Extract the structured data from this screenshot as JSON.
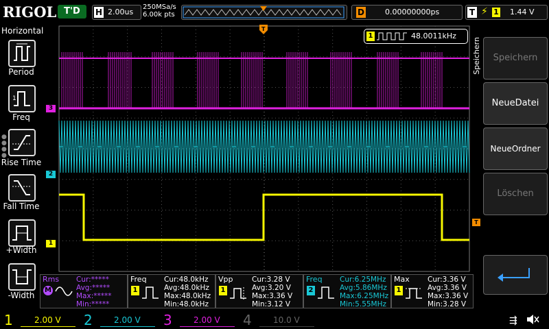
{
  "header": {
    "brand": "RIGOL",
    "run_mode": "T'D",
    "timebase_badge": "H",
    "timebase": "2.00us",
    "sample_rate": "250MSa/s",
    "memory_depth": "6.00k pts",
    "trigger_pos_badge": "D",
    "trigger_delay": "0.00000000ps",
    "trigger_badge": "T",
    "trigger_channel": "1",
    "trigger_level": "1.44 V"
  },
  "left_panel": {
    "title": "Horizontal",
    "buttons": [
      {
        "label": "Period"
      },
      {
        "label": "Freq"
      },
      {
        "label": "Rise Time"
      },
      {
        "label": "Fall Time"
      },
      {
        "label": "+Width"
      },
      {
        "label": "-Width"
      }
    ]
  },
  "waveform": {
    "freq_badge": "1",
    "freq_readout": "48.0011kHz",
    "ch3_marker": "3",
    "ch2_marker": "2",
    "ch1_marker": "1",
    "trigger_marker": "T",
    "colors": {
      "ch1": "#f7f700",
      "ch2": "#19c8d6",
      "ch3": "#e020e0",
      "ch4": "#3d6fd6",
      "trigger": "#f28c00"
    }
  },
  "right_panel": {
    "tab": "Speichern",
    "buttons": [
      {
        "label": "Speichern",
        "enabled": false
      },
      {
        "label": "NeueDatei",
        "enabled": true
      },
      {
        "label": "NeueOrdner",
        "enabled": true
      },
      {
        "label": "Löschen",
        "enabled": false
      }
    ]
  },
  "measurements": [
    {
      "title": "Rms",
      "channel": "M",
      "rows": [
        [
          "Cur:",
          "*****"
        ],
        [
          "Avg:",
          "*****"
        ],
        [
          "Max:",
          "*****"
        ],
        [
          "Min:",
          "*****"
        ]
      ]
    },
    {
      "title": "Freq",
      "channel": "1",
      "rows": [
        [
          "Cur:",
          "48.0kHz"
        ],
        [
          "Avg:",
          "48.0kHz"
        ],
        [
          "Max:",
          "48.0kHz"
        ],
        [
          "Min:",
          "48.0kHz"
        ]
      ]
    },
    {
      "title": "Vpp",
      "channel": "1",
      "rows": [
        [
          "Cur:",
          "3.28 V"
        ],
        [
          "Avg:",
          "3.20 V"
        ],
        [
          "Max:",
          "3.36 V"
        ],
        [
          "Min:",
          "3.12 V"
        ]
      ]
    },
    {
      "title": "Freq",
      "channel": "2",
      "rows": [
        [
          "Cur:",
          "6.25MHz"
        ],
        [
          "Avg:",
          "5.86MHz"
        ],
        [
          "Max:",
          "6.25MHz"
        ],
        [
          "Min:",
          "5.55MHz"
        ]
      ]
    },
    {
      "title": "Max",
      "channel": "1",
      "rows": [
        [
          "Cur:",
          "3.36 V"
        ],
        [
          "Avg:",
          "3.36 V"
        ],
        [
          "Max:",
          "3.36 V"
        ],
        [
          "Min:",
          "3.28 V"
        ]
      ]
    }
  ],
  "channels": [
    {
      "num": "1",
      "scale": "2.00 V"
    },
    {
      "num": "2",
      "scale": "2.00 V"
    },
    {
      "num": "3",
      "scale": "2.00 V"
    },
    {
      "num": "4",
      "scale": "10.0 V"
    }
  ]
}
